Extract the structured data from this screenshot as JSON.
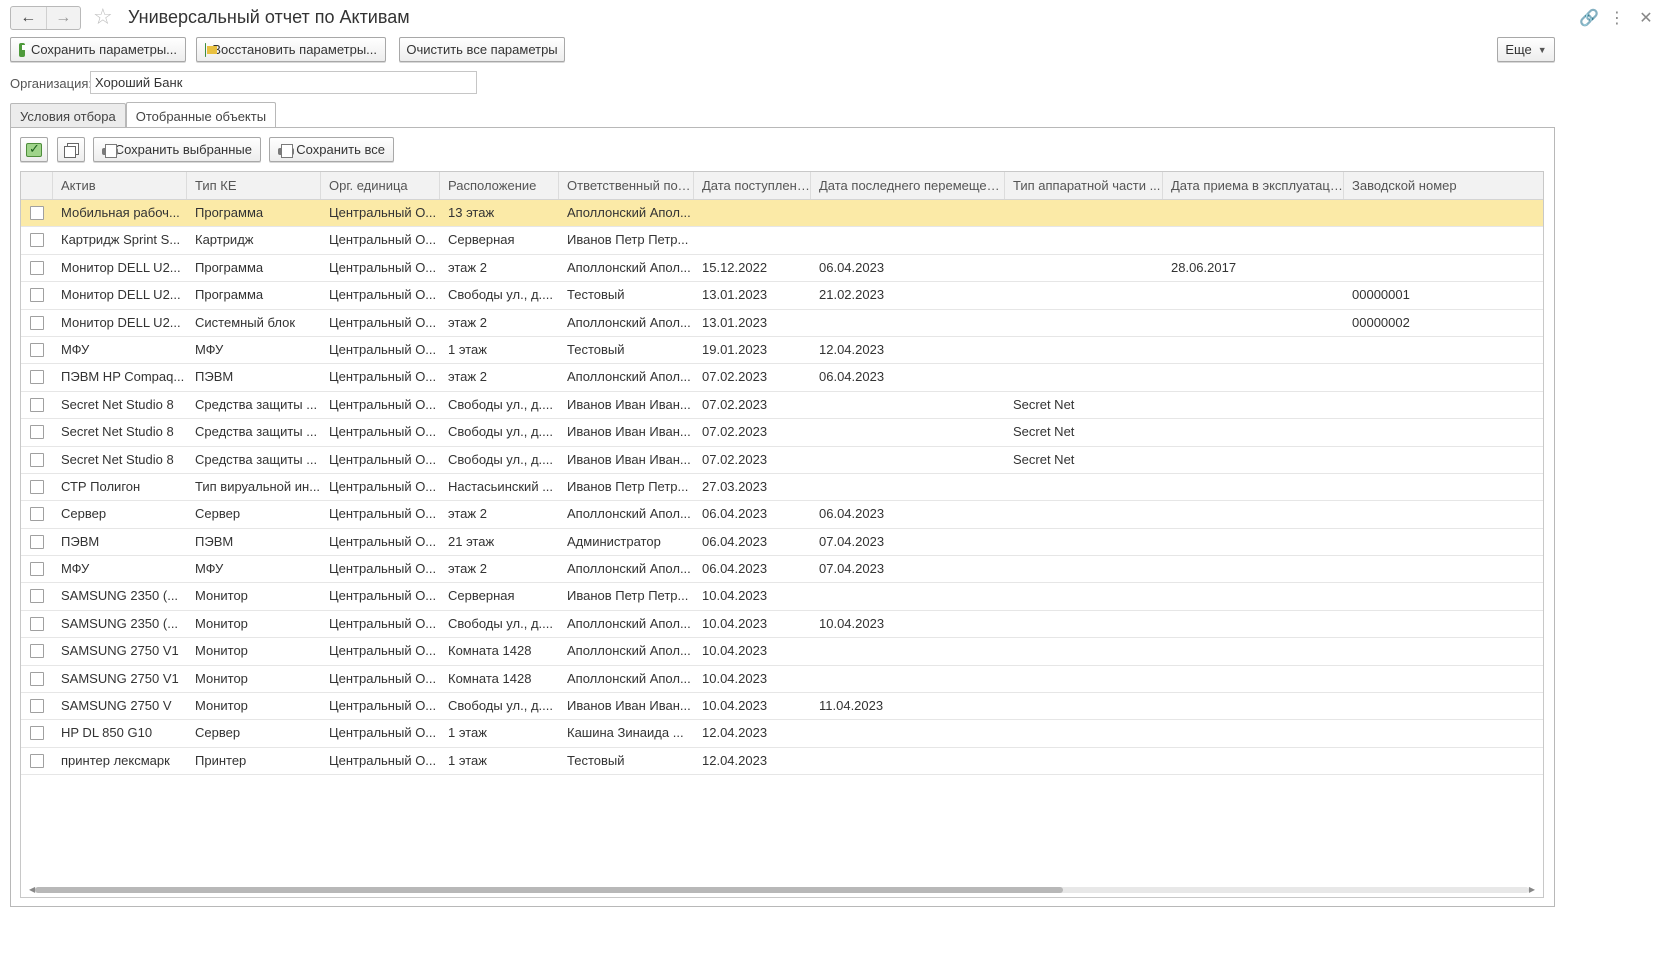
{
  "title": "Универсальный отчет по Активам",
  "toolbar": {
    "save_params": "Сохранить параметры...",
    "restore_params": "Восстановить параметры...",
    "clear_params": "Очистить все параметры",
    "more": "Еще"
  },
  "organization": {
    "label": "Организация:",
    "value": "Хороший Банк"
  },
  "tabs": [
    {
      "label": "Условия отбора"
    },
    {
      "label": "Отобранные объекты"
    }
  ],
  "panel_toolbar": {
    "save_selected": "Сохранить выбранные",
    "save_all": "Сохранить все"
  },
  "columns": [
    "Актив",
    "Тип КЕ",
    "Орг. единица",
    "Расположение",
    "Ответственный пол...",
    "Дата поступления",
    "Дата последнего перемещения",
    "Тип аппаратной части ...",
    "Дата приема в эксплуатацию",
    "Заводской номер"
  ],
  "rows": [
    [
      "Мобильная рабоч...",
      "Программа",
      "Центральный О...",
      "13 этаж",
      "Аполлонский Апол...",
      "",
      "",
      "",
      "",
      ""
    ],
    [
      "Картридж Sprint S...",
      "Картридж",
      "Центральный О...",
      "Серверная",
      "Иванов Петр Петр...",
      "",
      "",
      "",
      "",
      ""
    ],
    [
      "Монитор DELL U2...",
      "Программа",
      "Центральный О...",
      "этаж 2",
      "Аполлонский Апол...",
      "15.12.2022",
      "06.04.2023",
      "",
      "28.06.2017",
      ""
    ],
    [
      "Монитор DELL U2...",
      "Программа",
      "Центральный О...",
      "Свободы ул., д....",
      "Тестовый",
      "13.01.2023",
      "21.02.2023",
      "",
      "",
      "00000001"
    ],
    [
      "Монитор DELL U2...",
      "Системный блок",
      "Центральный О...",
      "этаж 2",
      "Аполлонский Апол...",
      "13.01.2023",
      "",
      "",
      "",
      "00000002"
    ],
    [
      "МФУ",
      "МФУ",
      "Центральный О...",
      "1 этаж",
      "Тестовый",
      "19.01.2023",
      "12.04.2023",
      "",
      "",
      ""
    ],
    [
      "ПЭВМ HP Compaq...",
      "ПЭВМ",
      "Центральный О...",
      "этаж 2",
      "Аполлонский Апол...",
      "07.02.2023",
      "06.04.2023",
      "",
      "",
      ""
    ],
    [
      "Secret Net Studio 8",
      "Средства защиты ...",
      "Центральный О...",
      "Свободы ул., д....",
      "Иванов Иван Иван...",
      "07.02.2023",
      "",
      "Secret Net",
      "",
      ""
    ],
    [
      "Secret Net Studio 8",
      "Средства защиты ...",
      "Центральный О...",
      "Свободы ул., д....",
      "Иванов Иван Иван...",
      "07.02.2023",
      "",
      "Secret Net",
      "",
      ""
    ],
    [
      "Secret Net Studio 8",
      "Средства защиты ...",
      "Центральный О...",
      "Свободы ул., д....",
      "Иванов Иван Иван...",
      "07.02.2023",
      "",
      "Secret Net",
      "",
      ""
    ],
    [
      "СТР Полигон",
      "Тип вируальной ин...",
      "Центральный О...",
      "Настасьинский ...",
      "Иванов Петр Петр...",
      "27.03.2023",
      "",
      "",
      "",
      ""
    ],
    [
      "Сервер",
      "Сервер",
      "Центральный О...",
      "этаж 2",
      "Аполлонский Апол...",
      "06.04.2023",
      "06.04.2023",
      "",
      "",
      ""
    ],
    [
      "ПЭВМ",
      "ПЭВМ",
      "Центральный О...",
      "21 этаж",
      "Администратор",
      "06.04.2023",
      "07.04.2023",
      "",
      "",
      ""
    ],
    [
      "МФУ",
      "МФУ",
      "Центральный О...",
      "этаж 2",
      "Аполлонский Апол...",
      "06.04.2023",
      "07.04.2023",
      "",
      "",
      ""
    ],
    [
      "SAMSUNG 2350 (...",
      "Монитор",
      "Центральный О...",
      "Серверная",
      "Иванов Петр Петр...",
      "10.04.2023",
      "",
      "",
      "",
      ""
    ],
    [
      "SAMSUNG 2350 (...",
      "Монитор",
      "Центральный О...",
      "Свободы ул., д....",
      "Аполлонский Апол...",
      "10.04.2023",
      "10.04.2023",
      "",
      "",
      ""
    ],
    [
      "SAMSUNG 2750 V1",
      "Монитор",
      "Центральный О...",
      "Комната 1428",
      "Аполлонский Апол...",
      "10.04.2023",
      "",
      "",
      "",
      ""
    ],
    [
      "SAMSUNG 2750 V1",
      "Монитор",
      "Центральный О...",
      "Комната 1428",
      "Аполлонский Апол...",
      "10.04.2023",
      "",
      "",
      "",
      ""
    ],
    [
      "SAMSUNG 2750 V",
      "Монитор",
      "Центральный О...",
      "Свободы ул., д....",
      "Иванов Иван Иван...",
      "10.04.2023",
      "11.04.2023",
      "",
      "",
      ""
    ],
    [
      "HP DL 850 G10",
      "Сервер",
      "Центральный О...",
      "1 этаж",
      "Кашина Зинаида ...",
      "12.04.2023",
      "",
      "",
      "",
      ""
    ],
    [
      "принтер лексмарк",
      "Принтер",
      "Центральный О...",
      "1 этаж",
      "Тестовый",
      "12.04.2023",
      "",
      "",
      "",
      ""
    ]
  ],
  "selected_row": 0,
  "colors": {
    "selected_row": "#fbeaa7",
    "header_bg": "#f2f2f2"
  },
  "icons": {
    "back": "arrow-left-icon",
    "forward": "arrow-right-icon",
    "favorite": "star-icon",
    "link": "link-icon",
    "menu": "kebab-menu-icon",
    "close": "close-icon"
  }
}
